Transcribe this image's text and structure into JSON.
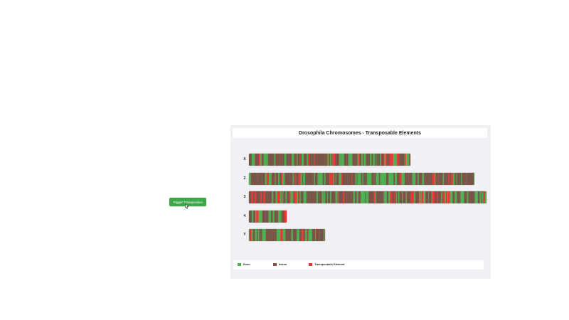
{
  "button": {
    "label": "Trigger Transposition"
  },
  "panel": {
    "title": "Drosophila Chromosomes - Transposable Elements"
  },
  "chromosomes": [
    {
      "name": "X",
      "length": 0.68,
      "seed": 11
    },
    {
      "name": "2",
      "length": 0.95,
      "seed": 23
    },
    {
      "name": "3",
      "length": 1.0,
      "seed": 37
    },
    {
      "name": "4",
      "length": 0.16,
      "seed": 41
    },
    {
      "name": "Y",
      "length": 0.32,
      "seed": 53
    }
  ],
  "legend": [
    {
      "label": "Exon",
      "color": "#4caf50"
    },
    {
      "label": "Intron",
      "color": "#795548"
    },
    {
      "label": "Transposable Element",
      "color": "#e53935"
    }
  ],
  "colors": {
    "exon": "#4caf50",
    "intron": "#795548",
    "transposable_element": "#e53935",
    "button": "#3da84b"
  },
  "icons": {
    "cursor": "pointer-cursor-icon"
  }
}
